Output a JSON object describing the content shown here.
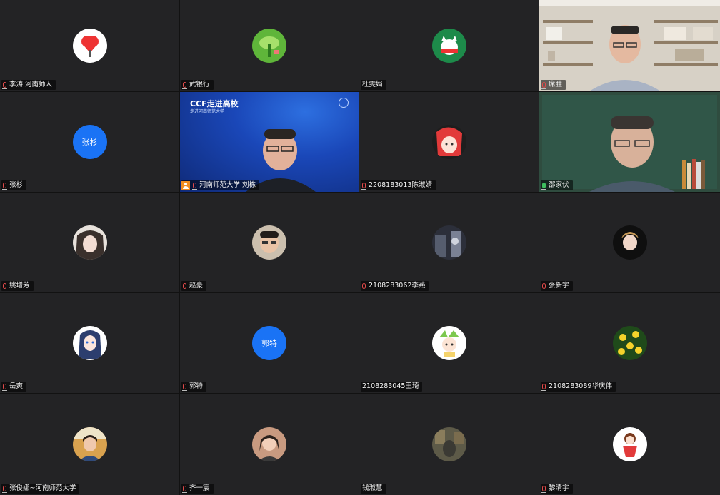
{
  "meeting": {
    "participants": [
      {
        "name": "李涛 河南师人",
        "mic": "muted",
        "avatar": "heart-tree-icon"
      },
      {
        "name": "武银行",
        "mic": "muted",
        "avatar": "green-leaf-icon"
      },
      {
        "name": "杜雯娟",
        "mic": "none",
        "avatar": "cat-icon"
      },
      {
        "name": "席胜",
        "mic": "muted",
        "avatar": "camera-video"
      },
      {
        "name": "张杉",
        "mic": "muted",
        "avatar_text": "张杉"
      },
      {
        "name": "河南师范大学 刘栋",
        "mic": "muted",
        "host": true,
        "avatar": "camera-video",
        "slide_title": "CCF走进高校",
        "slide_subtitle": "走进河南师范大学"
      },
      {
        "name": "2208183013陈淑婧",
        "mic": "muted",
        "avatar": "anime-girl-icon"
      },
      {
        "name": "邵家伏",
        "mic": "speaking",
        "active": true,
        "avatar": "camera-video"
      },
      {
        "name": "姚增芳",
        "mic": "muted",
        "avatar": "portrait-icon"
      },
      {
        "name": "赵豪",
        "mic": "muted",
        "avatar": "portrait-icon"
      },
      {
        "name": "2108283062李燕",
        "mic": "muted",
        "avatar": "dark-photo-icon"
      },
      {
        "name": "张新宇",
        "mic": "muted",
        "avatar": "portrait-icon"
      },
      {
        "name": "岳爽",
        "mic": "muted",
        "avatar": "anime-girl-icon"
      },
      {
        "name": "郭特",
        "mic": "muted",
        "avatar_text": "郭特"
      },
      {
        "name": "2108283045王琦",
        "mic": "none",
        "avatar": "cartoon-icon"
      },
      {
        "name": "2108283089华庆伟",
        "mic": "muted",
        "avatar": "flowers-icon"
      },
      {
        "name": "张俊娜~河南师范大学",
        "mic": "none",
        "avatar": "portrait-icon"
      },
      {
        "name": "齐一宸",
        "mic": "muted",
        "avatar": "portrait-icon"
      },
      {
        "name": "钱淑慧",
        "mic": "none",
        "avatar": "portrait-icon"
      },
      {
        "name": "黎清宇",
        "mic": "muted",
        "avatar": "cartoon-icon"
      }
    ]
  },
  "colors": {
    "tile_bg": "#232325",
    "active_border": "#e3b542",
    "avatar_blue": "#1a73f5",
    "muted_red": "#e24a4a",
    "speaking_green": "#3fbf5f"
  }
}
